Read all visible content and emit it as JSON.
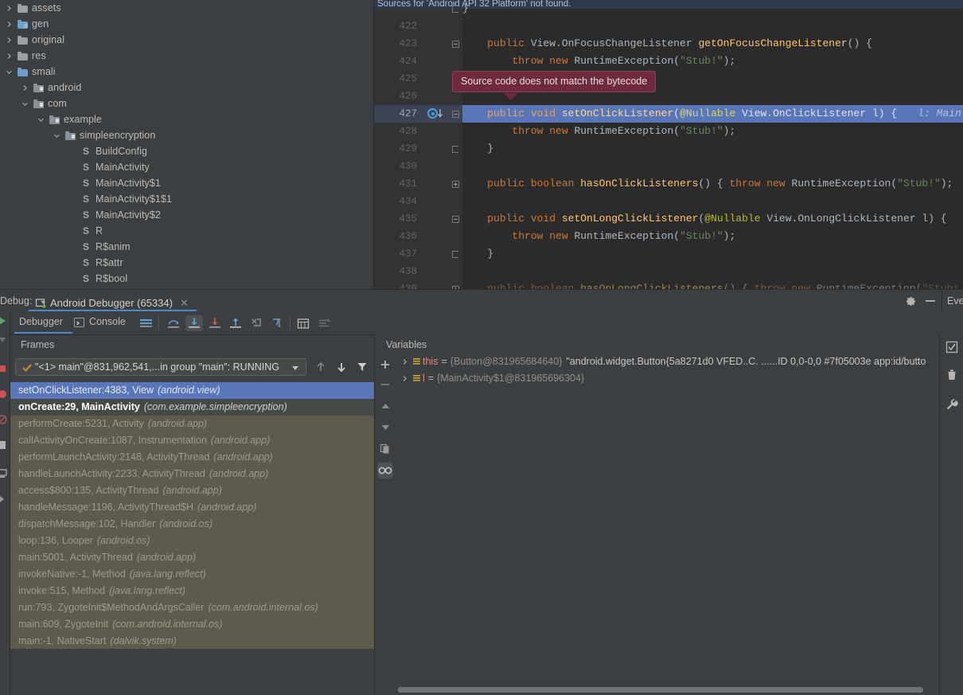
{
  "project_tree": {
    "items": [
      {
        "label": "assets",
        "depth": 0,
        "twisty": "collapsed",
        "icon": "folder-icon"
      },
      {
        "label": "gen",
        "depth": 0,
        "twisty": "collapsed",
        "icon": "folder-generated-icon"
      },
      {
        "label": "original",
        "depth": 0,
        "twisty": "collapsed",
        "icon": "folder-icon"
      },
      {
        "label": "res",
        "depth": 0,
        "twisty": "collapsed",
        "icon": "folder-icon"
      },
      {
        "label": "smali",
        "depth": 0,
        "twisty": "expanded",
        "icon": "folder-source-icon"
      },
      {
        "label": "android",
        "depth": 1,
        "twisty": "collapsed",
        "icon": "package-icon"
      },
      {
        "label": "com",
        "depth": 1,
        "twisty": "expanded",
        "icon": "package-icon"
      },
      {
        "label": "example",
        "depth": 2,
        "twisty": "expanded",
        "icon": "package-icon"
      },
      {
        "label": "simpleencryption",
        "depth": 3,
        "twisty": "expanded",
        "icon": "package-icon"
      },
      {
        "label": "BuildConfig",
        "depth": 4,
        "twisty": "none",
        "icon": "smali-file-icon"
      },
      {
        "label": "MainActivity",
        "depth": 4,
        "twisty": "none",
        "icon": "smali-file-icon"
      },
      {
        "label": "MainActivity$1",
        "depth": 4,
        "twisty": "none",
        "icon": "smali-file-icon"
      },
      {
        "label": "MainActivity$1$1",
        "depth": 4,
        "twisty": "none",
        "icon": "smali-file-icon"
      },
      {
        "label": "MainActivity$2",
        "depth": 4,
        "twisty": "none",
        "icon": "smali-file-icon"
      },
      {
        "label": "R",
        "depth": 4,
        "twisty": "none",
        "icon": "smali-file-icon"
      },
      {
        "label": "R$anim",
        "depth": 4,
        "twisty": "none",
        "icon": "smali-file-icon"
      },
      {
        "label": "R$attr",
        "depth": 4,
        "twisty": "none",
        "icon": "smali-file-icon"
      },
      {
        "label": "R$bool",
        "depth": 4,
        "twisty": "none",
        "icon": "smali-file-icon"
      }
    ]
  },
  "editor": {
    "notification": "Sources for 'Android API 32 Platform' not found.",
    "tooltip": "Source code does not match the bytecode",
    "inline_hint": "l: Main",
    "lines": [
      {
        "num": "",
        "indent": 0,
        "tokens": [
          {
            "t": "}",
            "c": "txt"
          }
        ],
        "fold": "end",
        "partial_top": true
      },
      {
        "num": "422",
        "tokens": []
      },
      {
        "num": "423",
        "fold": "collapse",
        "tokens": [
          {
            "t": "    ",
            "c": "txt"
          },
          {
            "t": "public ",
            "c": "kw"
          },
          {
            "t": "View.OnFocusChangeListener ",
            "c": "txt"
          },
          {
            "t": "getOnFocusChangeListener",
            "c": "fn"
          },
          {
            "t": "() {",
            "c": "txt"
          }
        ]
      },
      {
        "num": "424",
        "tokens": [
          {
            "t": "        ",
            "c": "txt"
          },
          {
            "t": "throw new ",
            "c": "kw"
          },
          {
            "t": "RuntimeException(",
            "c": "txt"
          },
          {
            "t": "\"Stub!\"",
            "c": "str"
          },
          {
            "t": ");",
            "c": "txt"
          }
        ]
      },
      {
        "num": "425",
        "fold": "end",
        "tokens": [
          {
            "t": "    }",
            "c": "txt"
          }
        ]
      },
      {
        "num": "426",
        "tokens": []
      },
      {
        "num": "427",
        "highlight": true,
        "fold": "collapse",
        "exec": true,
        "tokens": [
          {
            "t": "    ",
            "c": "txt"
          },
          {
            "t": "public void ",
            "c": "kw"
          },
          {
            "t": "setOnClickListener",
            "c": "fn"
          },
          {
            "t": "(",
            "c": "txt"
          },
          {
            "t": "@Nullable",
            "c": "ann"
          },
          {
            "t": " View.OnClickListener l) {",
            "c": "txt"
          }
        ]
      },
      {
        "num": "428",
        "tokens": [
          {
            "t": "        ",
            "c": "txt"
          },
          {
            "t": "throw new ",
            "c": "kw"
          },
          {
            "t": "RuntimeException(",
            "c": "txt"
          },
          {
            "t": "\"Stub!\"",
            "c": "str"
          },
          {
            "t": ");",
            "c": "txt"
          }
        ]
      },
      {
        "num": "429",
        "fold": "end",
        "tokens": [
          {
            "t": "    }",
            "c": "txt"
          }
        ]
      },
      {
        "num": "430",
        "tokens": []
      },
      {
        "num": "431",
        "fold": "expand",
        "tokens": [
          {
            "t": "    ",
            "c": "txt"
          },
          {
            "t": "public boolean ",
            "c": "kw"
          },
          {
            "t": "hasOnClickListeners",
            "c": "fn"
          },
          {
            "t": "() { ",
            "c": "txt"
          },
          {
            "t": "throw new ",
            "c": "kw"
          },
          {
            "t": "RuntimeException(",
            "c": "txt"
          },
          {
            "t": "\"Stub!\"",
            "c": "str"
          },
          {
            "t": ");",
            "c": "txt"
          }
        ]
      },
      {
        "num": "434",
        "tokens": []
      },
      {
        "num": "435",
        "fold": "collapse",
        "tokens": [
          {
            "t": "    ",
            "c": "txt"
          },
          {
            "t": "public void ",
            "c": "kw"
          },
          {
            "t": "setOnLongClickListener",
            "c": "fn"
          },
          {
            "t": "(",
            "c": "txt"
          },
          {
            "t": "@Nullable",
            "c": "ann"
          },
          {
            "t": " View.OnLongClickListener l) {",
            "c": "txt"
          }
        ]
      },
      {
        "num": "436",
        "tokens": [
          {
            "t": "        ",
            "c": "txt"
          },
          {
            "t": "throw new ",
            "c": "kw"
          },
          {
            "t": "RuntimeException(",
            "c": "txt"
          },
          {
            "t": "\"Stub!\"",
            "c": "str"
          },
          {
            "t": ");",
            "c": "txt"
          }
        ]
      },
      {
        "num": "437",
        "fold": "end",
        "tokens": [
          {
            "t": "    }",
            "c": "txt"
          }
        ]
      },
      {
        "num": "438",
        "tokens": []
      },
      {
        "num": "439",
        "fold": "expand",
        "dim": true,
        "tokens": [
          {
            "t": "    ",
            "c": "txt"
          },
          {
            "t": "public boolean ",
            "c": "kw"
          },
          {
            "t": "hasOnLongClickListeners",
            "c": "fn"
          },
          {
            "t": "() { ",
            "c": "txt"
          },
          {
            "t": "throw new ",
            "c": "kw"
          },
          {
            "t": "RuntimeException(",
            "c": "txt"
          },
          {
            "t": "\"Stub!",
            "c": "str"
          }
        ]
      }
    ]
  },
  "debug_header": {
    "label": "Debug:",
    "tab_title": "Android Debugger (65334)",
    "close_icon": "close-icon",
    "gear_icon": "gear-icon",
    "minimize_icon": "minimize-icon",
    "events_label": "Eve"
  },
  "toolbar": {
    "tab_debugger": "Debugger",
    "tab_console": "Console",
    "buttons": [
      {
        "name": "layout-settings-icon",
        "active": false
      },
      {
        "name": "step-over-icon",
        "active": false
      },
      {
        "name": "step-into-icon",
        "active": true
      },
      {
        "name": "force-step-into-icon",
        "active": false
      },
      {
        "name": "step-out-icon",
        "active": false
      },
      {
        "name": "drop-frame-icon",
        "active": false
      },
      {
        "name": "run-to-cursor-icon",
        "active": false
      },
      {
        "name": "evaluate-expression-icon",
        "active": false
      },
      {
        "name": "mute-breakpoints-icon",
        "active": false
      }
    ]
  },
  "frames": {
    "title": "Frames",
    "thread_selector": "\"<1> main\"@831,962,541,...in group \"main\": RUNNING",
    "nav_up_icon": "arrow-up-icon",
    "nav_down_icon": "arrow-down-icon",
    "filter_icon": "filter-icon",
    "rows": [
      {
        "method": "setOnClickListener:4383, View",
        "pkg": "(android.view)",
        "state": "selected"
      },
      {
        "method": "onCreate:29, MainActivity",
        "pkg": "(com.example.simpleencryption)",
        "state": "current"
      },
      {
        "method": "performCreate:5231, Activity",
        "pkg": "(android.app)",
        "state": "normal"
      },
      {
        "method": "callActivityOnCreate:1087, Instrumentation",
        "pkg": "(android.app)",
        "state": "normal"
      },
      {
        "method": "performLaunchActivity:2148, ActivityThread",
        "pkg": "(android.app)",
        "state": "normal"
      },
      {
        "method": "handleLaunchActivity:2233, ActivityThread",
        "pkg": "(android.app)",
        "state": "normal"
      },
      {
        "method": "access$800:135, ActivityThread",
        "pkg": "(android.app)",
        "state": "normal"
      },
      {
        "method": "handleMessage:1196, ActivityThread$H",
        "pkg": "(android.app)",
        "state": "normal"
      },
      {
        "method": "dispatchMessage:102, Handler",
        "pkg": "(android.os)",
        "state": "normal"
      },
      {
        "method": "loop:136, Looper",
        "pkg": "(android.os)",
        "state": "normal"
      },
      {
        "method": "main:5001, ActivityThread",
        "pkg": "(android.app)",
        "state": "normal"
      },
      {
        "method": "invokeNative:-1, Method",
        "pkg": "(java.lang.reflect)",
        "state": "normal"
      },
      {
        "method": "invoke:515, Method",
        "pkg": "(java.lang.reflect)",
        "state": "normal"
      },
      {
        "method": "run:793, ZygoteInit$MethodAndArgsCaller",
        "pkg": "(com.android.internal.os)",
        "state": "normal"
      },
      {
        "method": "main:609, ZygoteInit",
        "pkg": "(com.android.internal.os)",
        "state": "normal"
      },
      {
        "method": "main:-1, NativeStart",
        "pkg": "(dalvik.system)",
        "state": "normal"
      }
    ]
  },
  "variables": {
    "title": "Variables",
    "toolbar_icons": [
      {
        "name": "add-watch-icon",
        "active": false
      },
      {
        "name": "remove-watch-icon",
        "active": false
      },
      {
        "name": "move-up-icon",
        "active": false
      },
      {
        "name": "move-down-icon",
        "active": false
      },
      {
        "name": "copy-value-icon",
        "active": false
      },
      {
        "name": "inspect-icon",
        "active": true
      }
    ],
    "rows": [
      {
        "name": "this",
        "ref": "{Button@831965684640}",
        "value": "\"android.widget.Button{5a8271d0 VFED..C. ......ID 0,0-0,0 #7f05003e app:id/butto"
      },
      {
        "name": "l",
        "ref": "{MainActivity$1@831965696304}",
        "value": ""
      }
    ],
    "right_icons": [
      {
        "name": "settings-checkbox-icon"
      },
      {
        "name": "trash-icon"
      },
      {
        "name": "wrench-icon"
      }
    ]
  },
  "colors": {
    "accent_blue": "#4a88c7",
    "selection_blue": "#5976b8",
    "frame_olive": "#5e5a4c",
    "tooltip_maroon": "#6f2b3d",
    "panel_bg": "#3c3f41",
    "editor_bg": "#2b2b2b"
  }
}
